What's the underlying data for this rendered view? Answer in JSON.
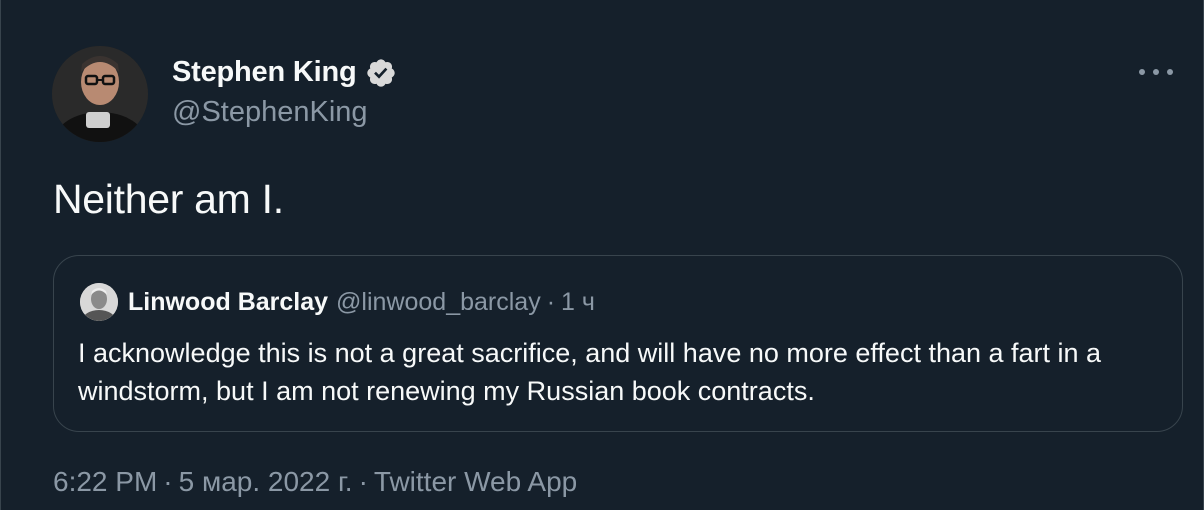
{
  "author": {
    "display_name": "Stephen King",
    "handle": "@StephenKing",
    "verified": true
  },
  "tweet": {
    "text": "Neither am I."
  },
  "quoted_tweet": {
    "display_name": "Linwood Barclay",
    "handle": "@linwood_barclay",
    "separator": "·",
    "time": "1 ч",
    "text": "I acknowledge this is not a great sacrifice, and will have no more effect than a fart in a windstorm, but I am not renewing my Russian book contracts."
  },
  "meta": {
    "time": "6:22 PM",
    "date": "5 мар. 2022 г.",
    "source": "Twitter Web App",
    "separator": "·"
  },
  "icons": {
    "verified": "verified-badge-icon",
    "more": "more-icon"
  },
  "colors": {
    "background": "#15202b",
    "primary_text": "#f7f9f9",
    "secondary_text": "#8b98a5",
    "border": "#38444d",
    "verified_badge": "#d9d9d9"
  }
}
